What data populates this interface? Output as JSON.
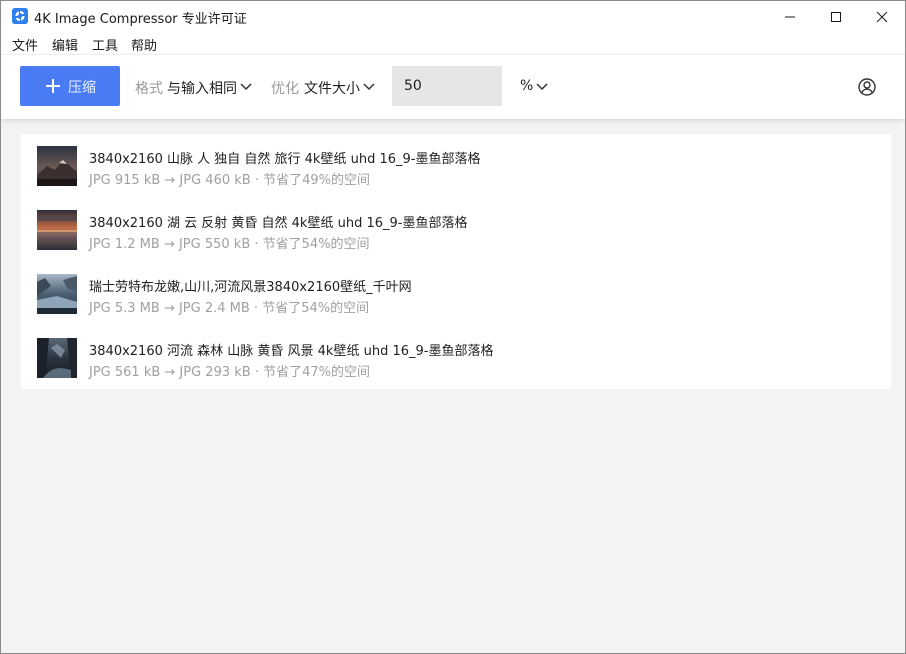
{
  "window": {
    "title": "4K Image Compressor 专业许可证",
    "icon": "app-logo-icon",
    "controls": [
      "minimize-icon",
      "maximize-icon",
      "close-icon"
    ]
  },
  "menu": {
    "items": [
      "文件",
      "编辑",
      "工具",
      "帮助"
    ]
  },
  "toolbar": {
    "compress_label": "压缩",
    "format_label": "格式",
    "format_value": "与输入相同",
    "optimize_label": "优化",
    "optimize_value": "文件大小",
    "quality_value": "50",
    "unit_value": "%",
    "accent_color": "#4a7cf6"
  },
  "files": [
    {
      "name": "3840x2160 山脉 人 独自 自然 旅行 4k壁纸 uhd 16_9-墨鱼部落格",
      "meta": "JPG 915 kB → JPG 460 kB · 节省了49%的空间"
    },
    {
      "name": "3840x2160 湖 云 反射 黄昏 自然 4k壁纸 uhd 16_9-墨鱼部落格",
      "meta": "JPG 1.2 MB → JPG 550 kB · 节省了54%的空间"
    },
    {
      "name": "瑞士劳特布龙嫩,山川,河流风景3840x2160壁纸_千叶网",
      "meta": "JPG 5.3 MB → JPG 2.4 MB · 节省了54%的空间"
    },
    {
      "name": "3840x2160 河流 森林 山脉 黄昏 风景 4k壁纸 uhd 16_9-墨鱼部落格",
      "meta": "JPG 561 kB → JPG 293 kB · 节省了47%的空间"
    }
  ]
}
